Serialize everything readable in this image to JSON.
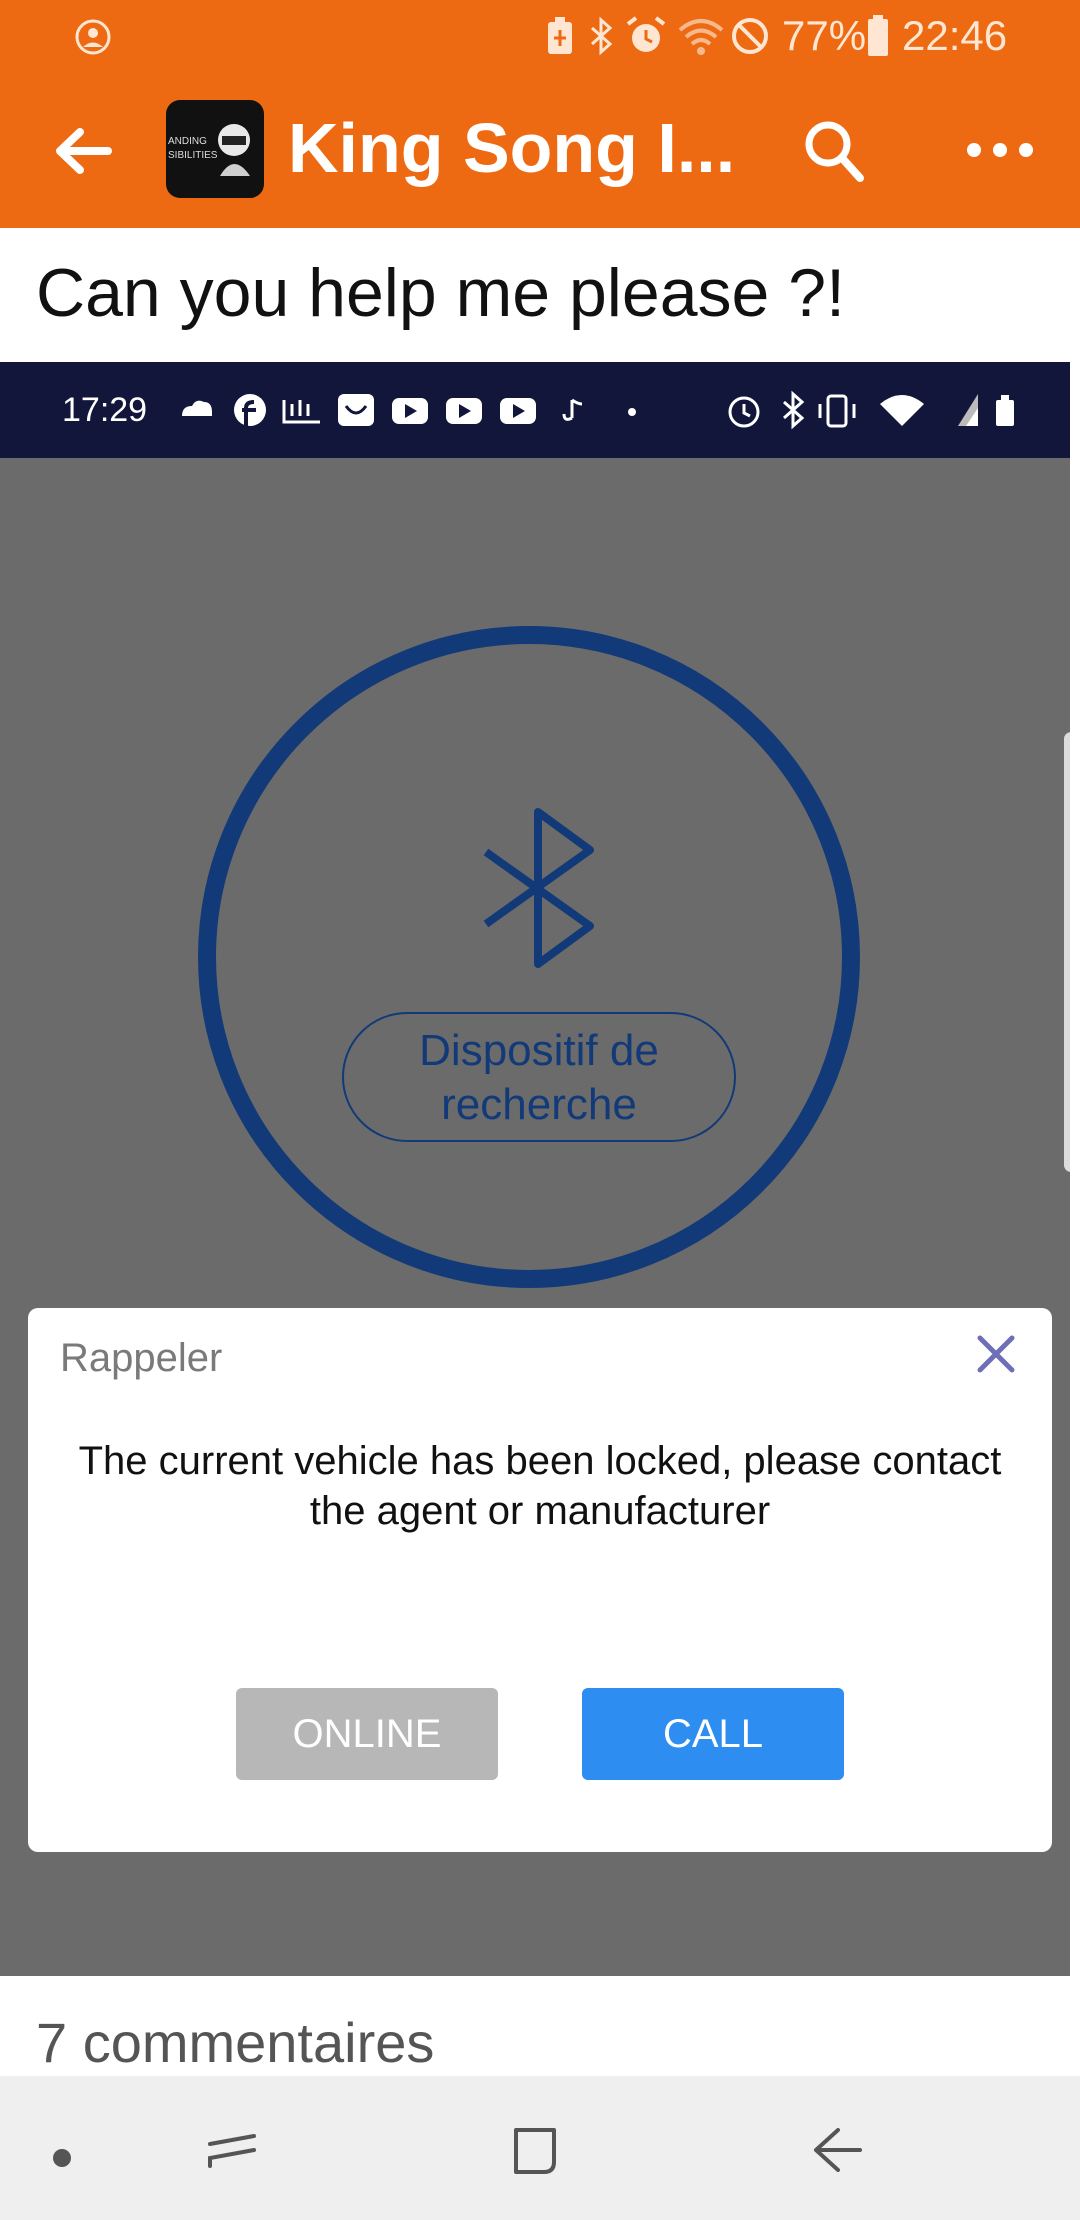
{
  "status_bar": {
    "battery": "77%",
    "time": "22:46",
    "icons": [
      "profile-icon",
      "battery-saver-icon",
      "bluetooth-icon",
      "alarm-icon",
      "wifi-icon",
      "do-not-disturb-icon",
      "battery-icon"
    ]
  },
  "app_bar": {
    "title": "King Song I...",
    "avatar_text_1": "ANDING",
    "avatar_text_2": "SIBILITIES",
    "icons": [
      "back-arrow-icon",
      "search-icon",
      "more-options-icon"
    ]
  },
  "post": {
    "title": "Can you help me please ?!"
  },
  "embedded_screenshot": {
    "status_time": "17:29",
    "search_button": {
      "line1": "Dispositif de",
      "line2": "recherche"
    },
    "dialog": {
      "title": "Rappeler",
      "message": "The current vehicle has been locked, please contact the agent or manufacturer",
      "online_label": "ONLINE",
      "call_label": "CALL"
    }
  },
  "comments": {
    "label": "7 commentaires"
  },
  "nav_bar": {
    "icons": [
      "dot-icon",
      "recent-apps-icon",
      "home-icon",
      "back-icon"
    ]
  },
  "colors": {
    "accent": "#ee6a12",
    "dialog_call": "#2d8df0",
    "ring": "#123a78"
  }
}
